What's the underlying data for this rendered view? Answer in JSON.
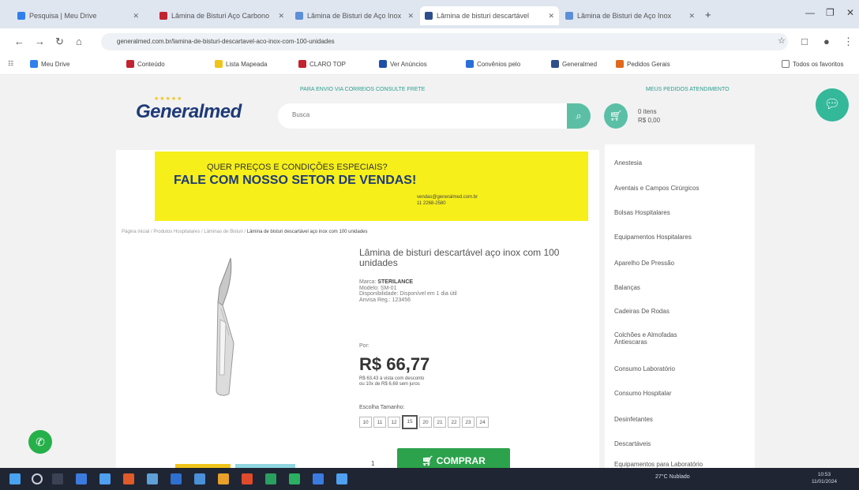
{
  "browser": {
    "tabs": [
      {
        "label": "Pesquisa | Meu Drive"
      },
      {
        "label": "Lâmina de Bisturi Aço Carbono"
      },
      {
        "label": "Lâmina de Bisturi de Aço Inox"
      },
      {
        "label": "Lâmina de bisturi descartável"
      },
      {
        "label": "Lâmina de Bisturi de Aço Inox"
      }
    ],
    "new_tab": "+",
    "url": "generalmed.com.br/lamina-de-bisturi-descartavel-aco-inox-com-100-unidades",
    "bookmarks": [
      {
        "label": "Meu Drive"
      },
      {
        "label": "Conteúdo"
      },
      {
        "label": "Lista Mapeada"
      },
      {
        "label": "CLARO TOP"
      },
      {
        "label": "Ver Anúncios"
      },
      {
        "label": "Convênios pelo"
      },
      {
        "label": "Generalmed"
      },
      {
        "label": "Pedidos Gerais"
      },
      {
        "label": "Todos os favoritos"
      }
    ]
  },
  "site": {
    "notice": "PARA ENVIO VIA CORREIOS CONSULTE FRETE",
    "links": "MEUS PEDIDOS   ATENDIMENTO",
    "logo": "Generalmed",
    "logo_stars": "★★★★★",
    "search_placeholder": "Busca",
    "cart_label": "0 itens",
    "cart_total": "R$ 0,00"
  },
  "banner": {
    "line1": "QUER PREÇOS E CONDIÇÕES ESPECIAIS?",
    "line2": "FALE COM NOSSO SETOR DE VENDAS!",
    "email": "vendas@generalmed.com.br",
    "phone": "11 2268-2580"
  },
  "breadcrumb": {
    "path": "Página inicial / Produtos Hospitalares / Lâminas de Bisturi / ",
    "current": "Lâmina de bisturi descartável aço inox com 100 unidades"
  },
  "product": {
    "title": "Lâmina de bisturi descartável aço inox com 100 unidades",
    "brand_label": "Marca:",
    "brand": "STERILANCE",
    "model": "Modelo: SM-01",
    "availability": "Disponibilidade: Disponível em 1 dia útil",
    "anvisa": "Anvisa Reg.: 123456",
    "price_label": "Por:",
    "price": "R$ 66,77",
    "installment1": "R$ 63,43 à vista com desconto",
    "installment2": "ou 10x de R$ 6,68 sem juros",
    "size_label": "Escolha Tamanho:",
    "sizes": [
      "10",
      "11",
      "12",
      "15",
      "20",
      "21",
      "22",
      "23",
      "24"
    ],
    "selected_size": "15",
    "qty": "1",
    "buy_label": "COMPRAR"
  },
  "sidebar": {
    "categories": [
      "Anestesia",
      "Aventais e Campos Cirúrgicos",
      "Bolsas Hospitalares",
      "Equipamentos Hospitalares",
      "Aparelho De Pressão",
      "Balanças",
      "Cadeiras De Rodas",
      "Colchões e Almofadas Antiescaras",
      "Consumo Laboratório",
      "Consumo Hospitalar",
      "Desinfetantes",
      "Descartáveis",
      "Equipamentos para Laboratório"
    ]
  },
  "taskbar": {
    "weather": "27°C Nublado",
    "time": "10:53",
    "date": "11/01/2024"
  }
}
